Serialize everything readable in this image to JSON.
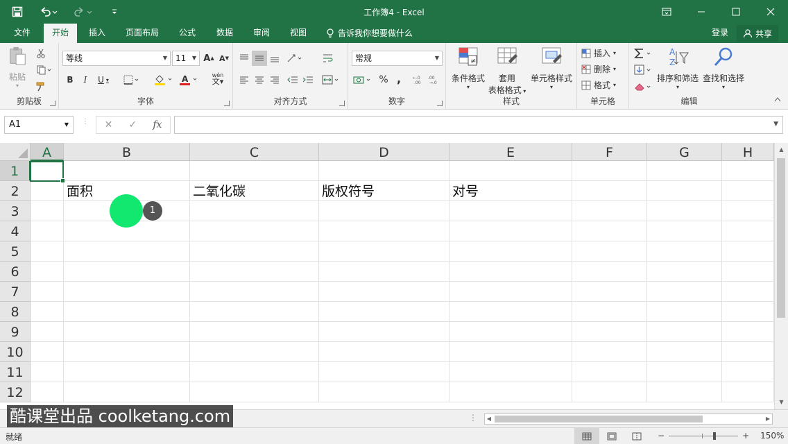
{
  "window": {
    "title": "工作簿4 - Excel"
  },
  "tabs": [
    "文件",
    "开始",
    "插入",
    "页面布局",
    "公式",
    "数据",
    "审阅",
    "视图"
  ],
  "tell_me": "告诉我你想要做什么",
  "account": {
    "login": "登录",
    "share": "共享"
  },
  "ribbon": {
    "clipboard": {
      "paste": "粘贴",
      "label": "剪贴板"
    },
    "font": {
      "name": "等线",
      "size": "11",
      "bold": "B",
      "italic": "I",
      "underline": "U",
      "label": "字体",
      "grow": "A",
      "shrink": "A",
      "font_color_letter": "A",
      "wen": "wén"
    },
    "alignment": {
      "label": "对齐方式"
    },
    "number": {
      "format": "常规",
      "percent": "%",
      "comma": ",",
      "label": "数字"
    },
    "styles": {
      "conditional": "条件格式",
      "table_line1": "套用",
      "table_line2": "表格格式",
      "cell_styles": "单元格样式",
      "label": "样式"
    },
    "cells": {
      "insert": "插入",
      "delete": "删除",
      "format": "格式",
      "label": "单元格"
    },
    "editing": {
      "sort": "排序和筛选",
      "find": "查找和选择",
      "label": "编辑"
    }
  },
  "formula_bar": {
    "name_box": "A1",
    "fx": "fx",
    "value": ""
  },
  "columns": [
    "A",
    "B",
    "C",
    "D",
    "E",
    "F",
    "G",
    "H"
  ],
  "rows": [
    "1",
    "2",
    "3",
    "4",
    "5",
    "6",
    "7",
    "8",
    "9",
    "10",
    "11",
    "12"
  ],
  "cells": {
    "B2": "面积",
    "C2": "二氧化碳",
    "D2": "版权符号",
    "E2": "对号"
  },
  "tutorial": {
    "step": "1"
  },
  "status": {
    "ready": "就绪",
    "zoom": "150%"
  },
  "watermark": "酷课堂出品 coolketang.com",
  "colors": {
    "accent": "#217346",
    "click_marker": "#12e870"
  }
}
